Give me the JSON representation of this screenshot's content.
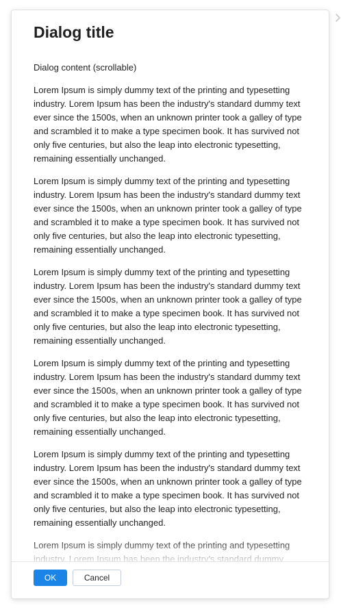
{
  "dialog": {
    "title": "Dialog title",
    "subtitle": "Dialog content (scrollable)",
    "paragraphs": [
      "Lorem Ipsum is simply dummy text of the printing and typesetting industry. Lorem Ipsum has been the industry's standard dummy text ever since the 1500s, when an unknown printer took a galley of type and scrambled it to make a type specimen book. It has survived not only five centuries, but also the leap into electronic typesetting, remaining essentially unchanged.",
      "Lorem Ipsum is simply dummy text of the printing and typesetting industry. Lorem Ipsum has been the industry's standard dummy text ever since the 1500s, when an unknown printer took a galley of type and scrambled it to make a type specimen book. It has survived not only five centuries, but also the leap into electronic typesetting, remaining essentially unchanged.",
      "Lorem Ipsum is simply dummy text of the printing and typesetting industry. Lorem Ipsum has been the industry's standard dummy text ever since the 1500s, when an unknown printer took a galley of type and scrambled it to make a type specimen book. It has survived not only five centuries, but also the leap into electronic typesetting, remaining essentially unchanged.",
      "Lorem Ipsum is simply dummy text of the printing and typesetting industry. Lorem Ipsum has been the industry's standard dummy text ever since the 1500s, when an unknown printer took a galley of type and scrambled it to make a type specimen book. It has survived not only five centuries, but also the leap into electronic typesetting, remaining essentially unchanged.",
      "Lorem Ipsum is simply dummy text of the printing and typesetting industry. Lorem Ipsum has been the industry's standard dummy text ever since the 1500s, when an unknown printer took a galley of type and scrambled it to make a type specimen book. It has survived not only five centuries, but also the leap into electronic typesetting, remaining essentially unchanged.",
      "Lorem Ipsum is simply dummy text of the printing and typesetting industry. Lorem Ipsum has been the industry's standard dummy"
    ],
    "ok_label": "OK",
    "cancel_label": "Cancel"
  },
  "icons": {
    "side_chevron": "chevron-right-icon"
  },
  "colors": {
    "primary": "#1b84e7",
    "text": "#1f1f1f",
    "border": "#e2e2e2"
  }
}
